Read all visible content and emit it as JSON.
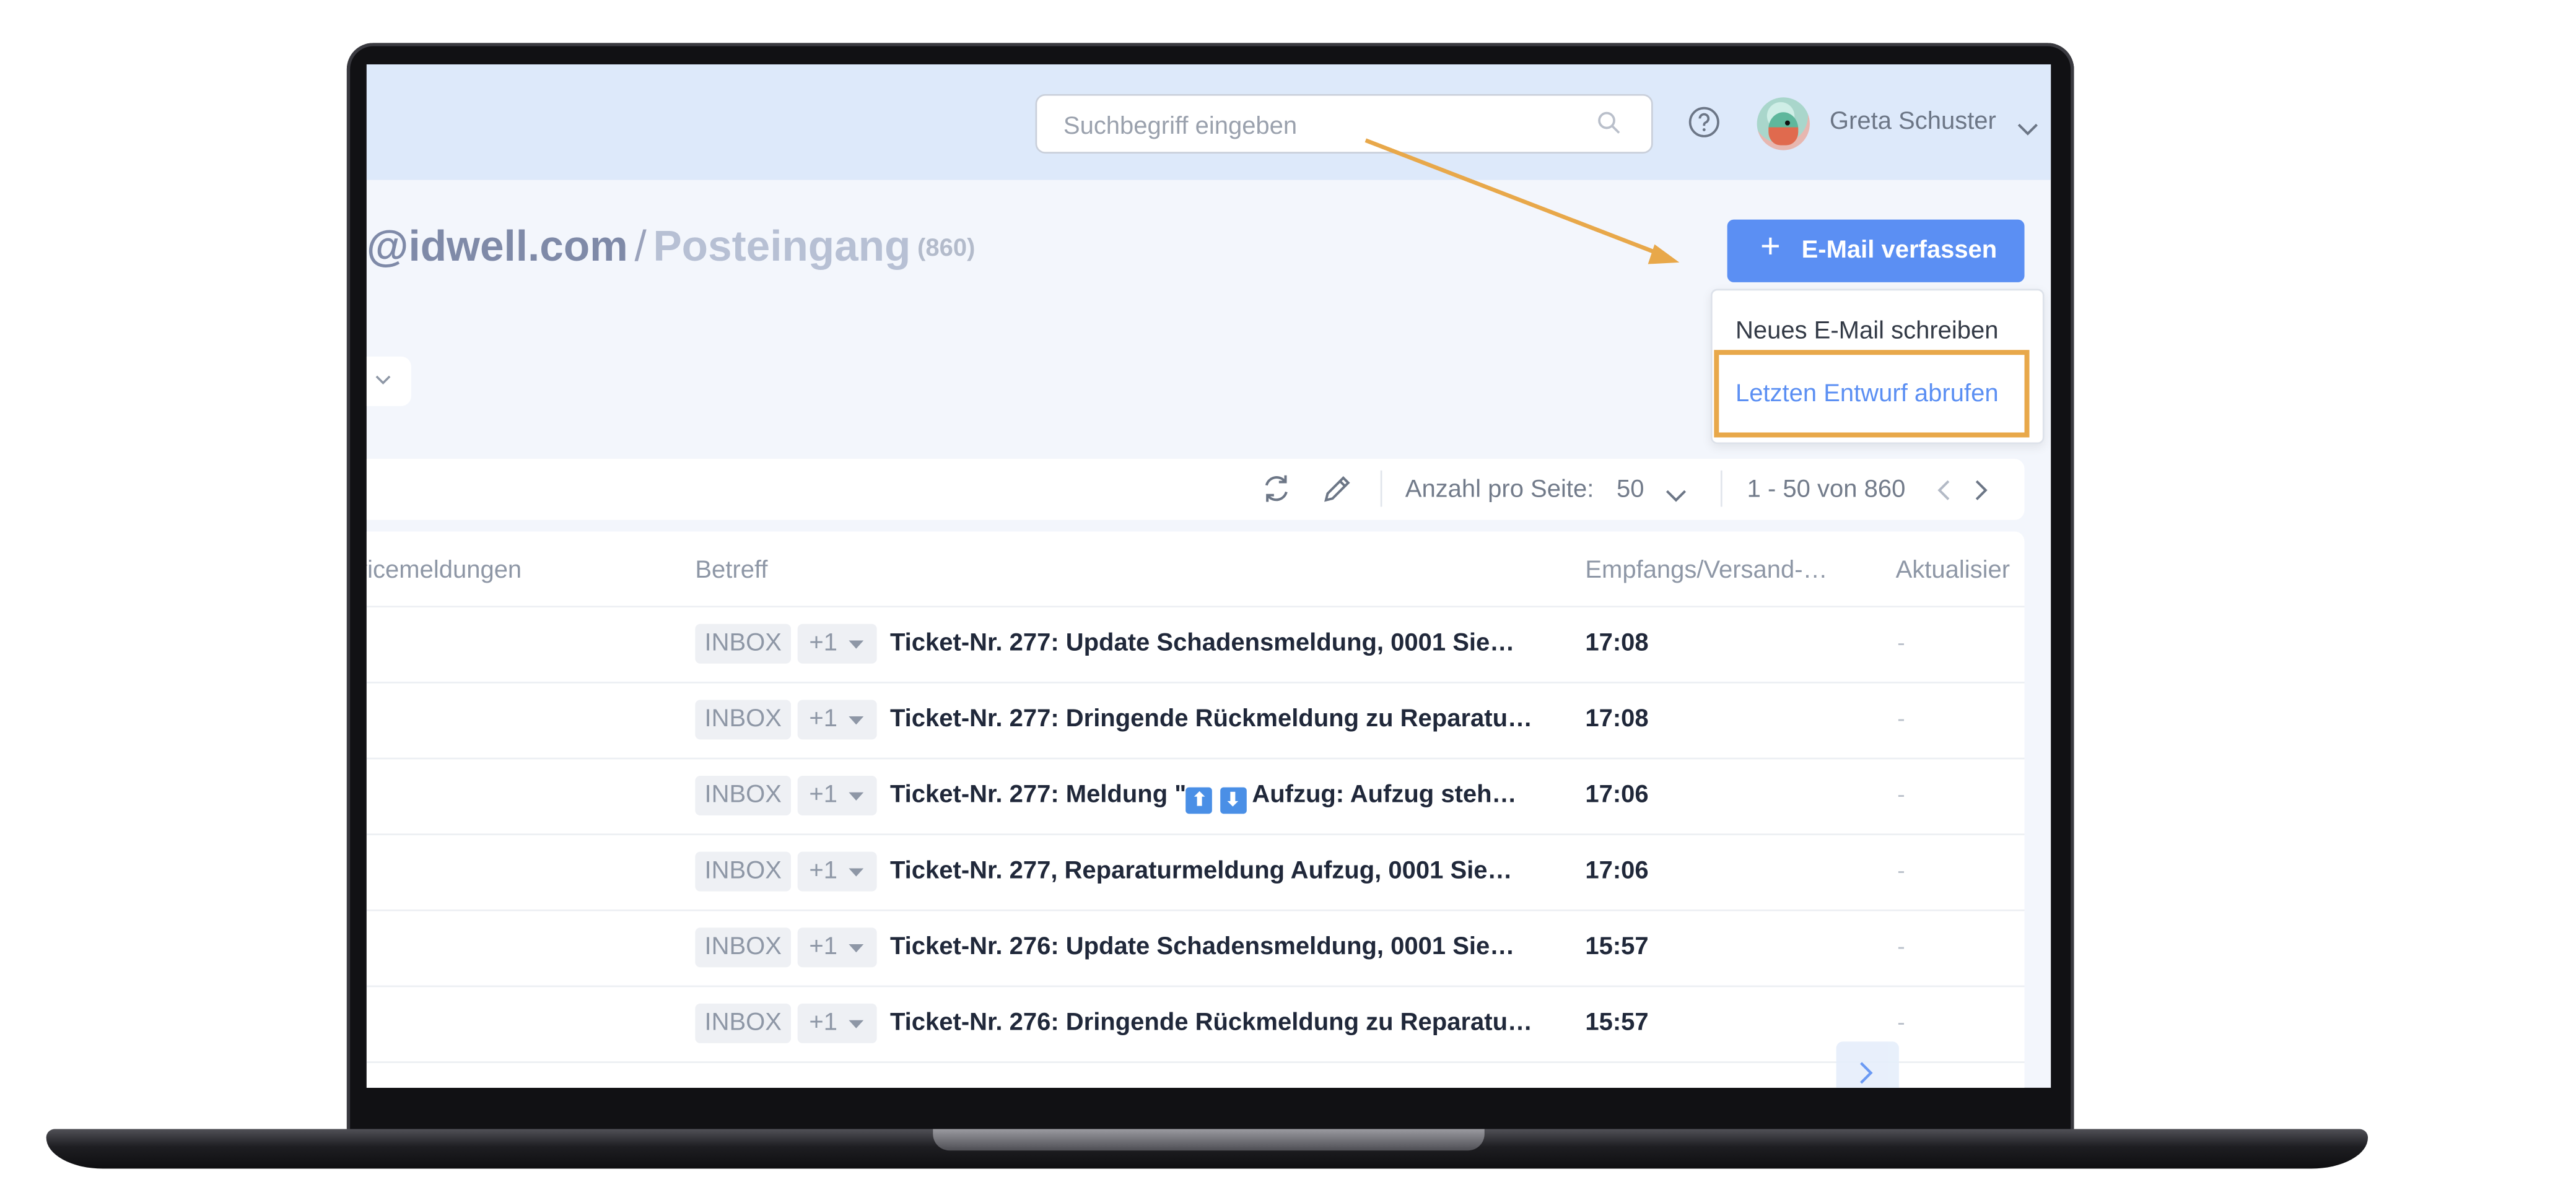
{
  "header": {
    "search_placeholder": "Suchbegriff eingeben",
    "user_name": "Greta Schuster"
  },
  "title": {
    "mailbox": "@idwell.com",
    "separator": "/",
    "folder": "Posteingang",
    "count": "(860)"
  },
  "compose": {
    "plus": "+",
    "label": "E-Mail verfassen",
    "menu": [
      {
        "label": "Neues E-Mail schreiben"
      },
      {
        "label": "Letzten Entwurf abrufen"
      }
    ]
  },
  "toolbar": {
    "per_page_label": "Anzahl pro Seite:",
    "per_page_value": "50",
    "range": "1 - 50 von 860"
  },
  "table": {
    "columns": [
      "rvicemeldungen",
      "Betreff",
      "Empfangs/Versand-…",
      "Aktualisier"
    ],
    "rows": [
      {
        "tag": "INBOX",
        "more": "+1",
        "subject": "Ticket-Nr. 277: Update Schadensmeldung, 0001 Sie…",
        "time": "17:08",
        "updated": "-"
      },
      {
        "tag": "INBOX",
        "more": "+1",
        "subject": "Ticket-Nr. 277: Dringende Rückmeldung zu Reparatu…",
        "time": "17:08",
        "updated": "-"
      },
      {
        "tag": "INBOX",
        "more": "+1",
        "subject_prefix": "Ticket-Nr. 277: Meldung \"",
        "emoji1": "⬆",
        "emoji2": "⬇",
        "subject_suffix": "Aufzug: Aufzug steh…",
        "time": "17:06",
        "updated": "-"
      },
      {
        "tag": "INBOX",
        "more": "+1",
        "subject": "Ticket-Nr. 277, Reparaturmeldung Aufzug, 0001 Sie…",
        "time": "17:06",
        "updated": "-"
      },
      {
        "tag": "INBOX",
        "more": "+1",
        "subject": "Ticket-Nr. 276: Update Schadensmeldung, 0001 Sie…",
        "time": "15:57",
        "updated": "-"
      },
      {
        "tag": "INBOX",
        "more": "+1",
        "subject": "Ticket-Nr. 276: Dringende Rückmeldung zu Reparatu…",
        "time": "15:57",
        "updated": "-"
      }
    ]
  },
  "colors": {
    "accent": "#5b8ff3",
    "highlight": "#e8a84a",
    "header_bg": "#dde9fa"
  }
}
